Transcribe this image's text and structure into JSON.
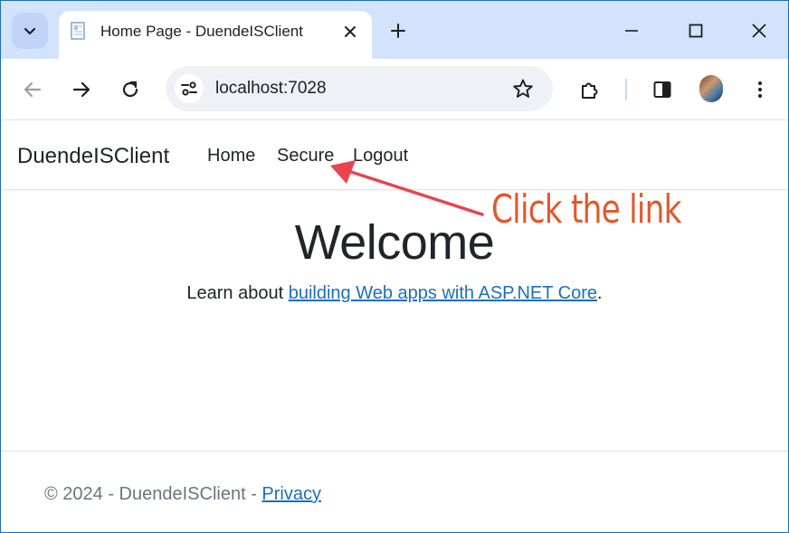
{
  "browser": {
    "tab_title": "Home Page - DuendeISClient",
    "url": "localhost:7028",
    "icons": {
      "tab_search": "chevron-down-icon",
      "favicon": "page-icon",
      "tab_close": "close-icon",
      "new_tab": "plus-icon",
      "minimize": "minimize-icon",
      "maximize": "maximize-icon",
      "close_window": "close-icon",
      "back": "arrow-left-icon",
      "forward": "arrow-right-icon",
      "reload": "reload-icon",
      "site_info": "tune-icon",
      "bookmark": "star-icon",
      "extensions": "puzzle-icon",
      "side_panel": "side-panel-icon",
      "menu": "more-vertical-icon"
    },
    "colors": {
      "tabstrip": "#d3e3fd",
      "omnibox": "#eef1f6"
    }
  },
  "site": {
    "brand": "DuendeISClient",
    "nav": [
      {
        "label": "Home"
      },
      {
        "label": "Secure"
      },
      {
        "label": "Logout"
      }
    ],
    "welcome": "Welcome",
    "learn_prefix": "Learn about ",
    "learn_link": "building Web apps with ASP.NET Core",
    "learn_suffix": ".",
    "footer_text": "© 2024 - DuendeISClient - ",
    "footer_link": "Privacy",
    "link_color": "#1b6ec2"
  },
  "annotation": {
    "text": "Click the link",
    "color": "#e05a2b",
    "arrow_color": "#e8434f"
  }
}
